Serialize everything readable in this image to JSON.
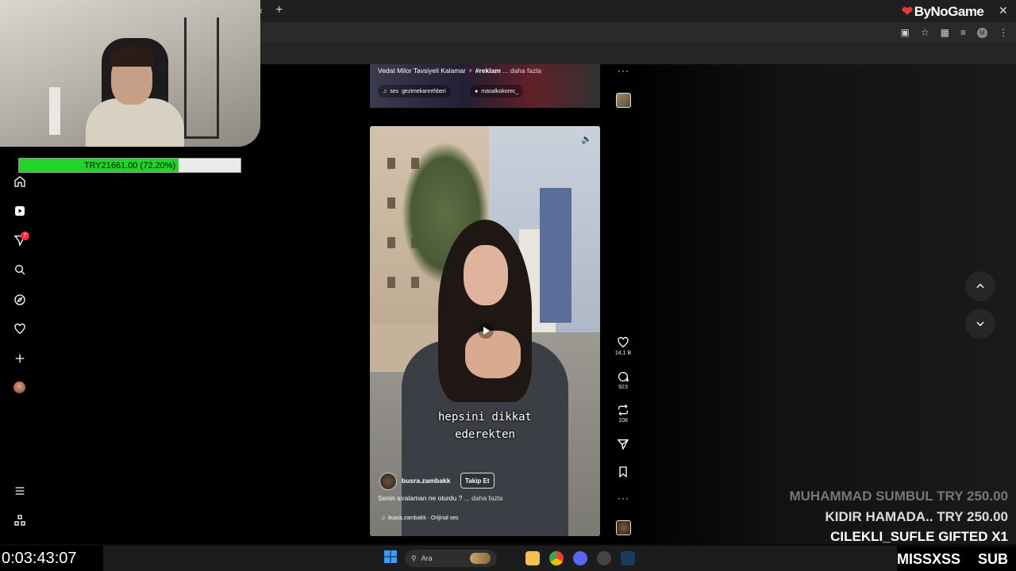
{
  "browser": {
    "new_tab_symbol": "+",
    "close_tab_symbol": "×",
    "window_close_symbol": "✕",
    "profile_initial": "M"
  },
  "overlay": {
    "brand": "ByNoGame",
    "goal_text": "TRY21661.00 (72.20%)",
    "goal_percent": 72.2,
    "goal_label": "",
    "stream_timer": "0:03:43:07",
    "alerts": [
      "MUHAMMAD SUMBUL  TRY 250.00",
      "KIDIR HAMADA..  TRY 250.00",
      "CILEKLI_SUFLE  GIFTED X1"
    ],
    "sub_handle": "@MISSXSS",
    "sub_label": "SUB"
  },
  "sidebar": {
    "notification_count": "7",
    "items": [
      "home-icon",
      "reels-icon",
      "messages-icon",
      "search-icon",
      "explore-icon",
      "notifications-icon",
      "create-icon",
      "profile-avatar"
    ]
  },
  "feed": {
    "prev_post": {
      "caption_user": "Vedat Milor Tavsiyeli Kalamar",
      "caption_tag": "#reklam",
      "more_label": "... daha fazla",
      "audio_prefix": "ses",
      "audio_source": "gezimekanrehberi",
      "tagged_user": "masalkokorec_"
    },
    "reel": {
      "subtitle_line1": "hepsini dikkat",
      "subtitle_line2": "ederekten",
      "username": "busra.zambakk",
      "follow_label": "Takip Et",
      "caption": "Senin sıralaman ne olurdu ?",
      "more_label": "... daha fazla",
      "audio": "busra.zambakk · Orijinal ses",
      "likes": "14,1 B",
      "comments": "923",
      "reposts": "108"
    }
  },
  "taskbar": {
    "search_placeholder": "Ara"
  },
  "colors": {
    "goal_fill": "#22d32a",
    "badge": "#ff3040",
    "brand_logo": "#e53935"
  }
}
